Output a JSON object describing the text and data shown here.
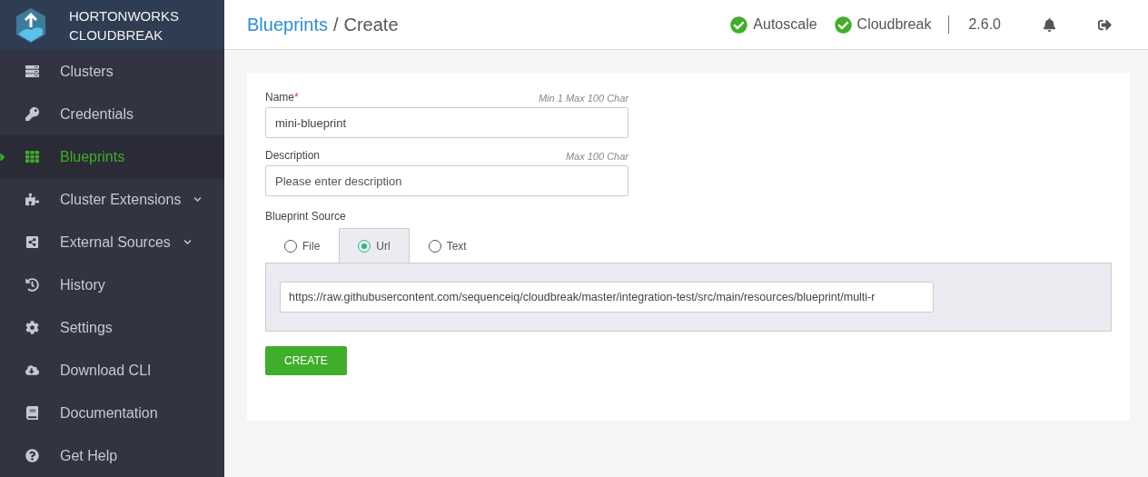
{
  "brand": {
    "line1": "HORTONWORKS",
    "line2": "CLOUDBREAK"
  },
  "sidebar": {
    "items": [
      {
        "label": "Clusters",
        "selected": false
      },
      {
        "label": "Credentials",
        "selected": false
      },
      {
        "label": "Blueprints",
        "selected": true
      },
      {
        "label": "Cluster Extensions",
        "selected": false,
        "expanded": false
      },
      {
        "label": "External Sources",
        "selected": false,
        "expanded": false
      },
      {
        "label": "History",
        "selected": false
      },
      {
        "label": "Settings",
        "selected": false
      },
      {
        "label": "Download CLI",
        "selected": false
      },
      {
        "label": "Documentation",
        "selected": false
      },
      {
        "label": "Get Help",
        "selected": false
      }
    ]
  },
  "header": {
    "breadcrumb": [
      {
        "label": "Blueprints",
        "kind": "link"
      },
      {
        "label": "/",
        "kind": "separator"
      },
      {
        "label": "Create",
        "kind": "current"
      }
    ],
    "statuses": [
      {
        "label": "Autoscale",
        "ok": true
      },
      {
        "label": "Cloudbreak",
        "ok": true
      }
    ],
    "version": "2.6.0"
  },
  "form": {
    "fields": [
      {
        "label": "Name",
        "required_mark": "*",
        "hint": "Min 1 Max 100 Char",
        "value": "mini-blueprint"
      },
      {
        "label": "Description",
        "hint": "Max 100 Char",
        "placeholder": "Please enter description"
      }
    ],
    "source": {
      "label": "Blueprint Source",
      "tabs": [
        {
          "label": "File",
          "selected": false
        },
        {
          "label": "Url",
          "selected": true
        },
        {
          "label": "Text",
          "selected": false
        }
      ],
      "value": "https://raw.githubusercontent.com/sequenceiq/cloudbreak/master/integration-test/src/main/resources/blueprint/multi-r"
    },
    "submit": "CREATE"
  }
}
